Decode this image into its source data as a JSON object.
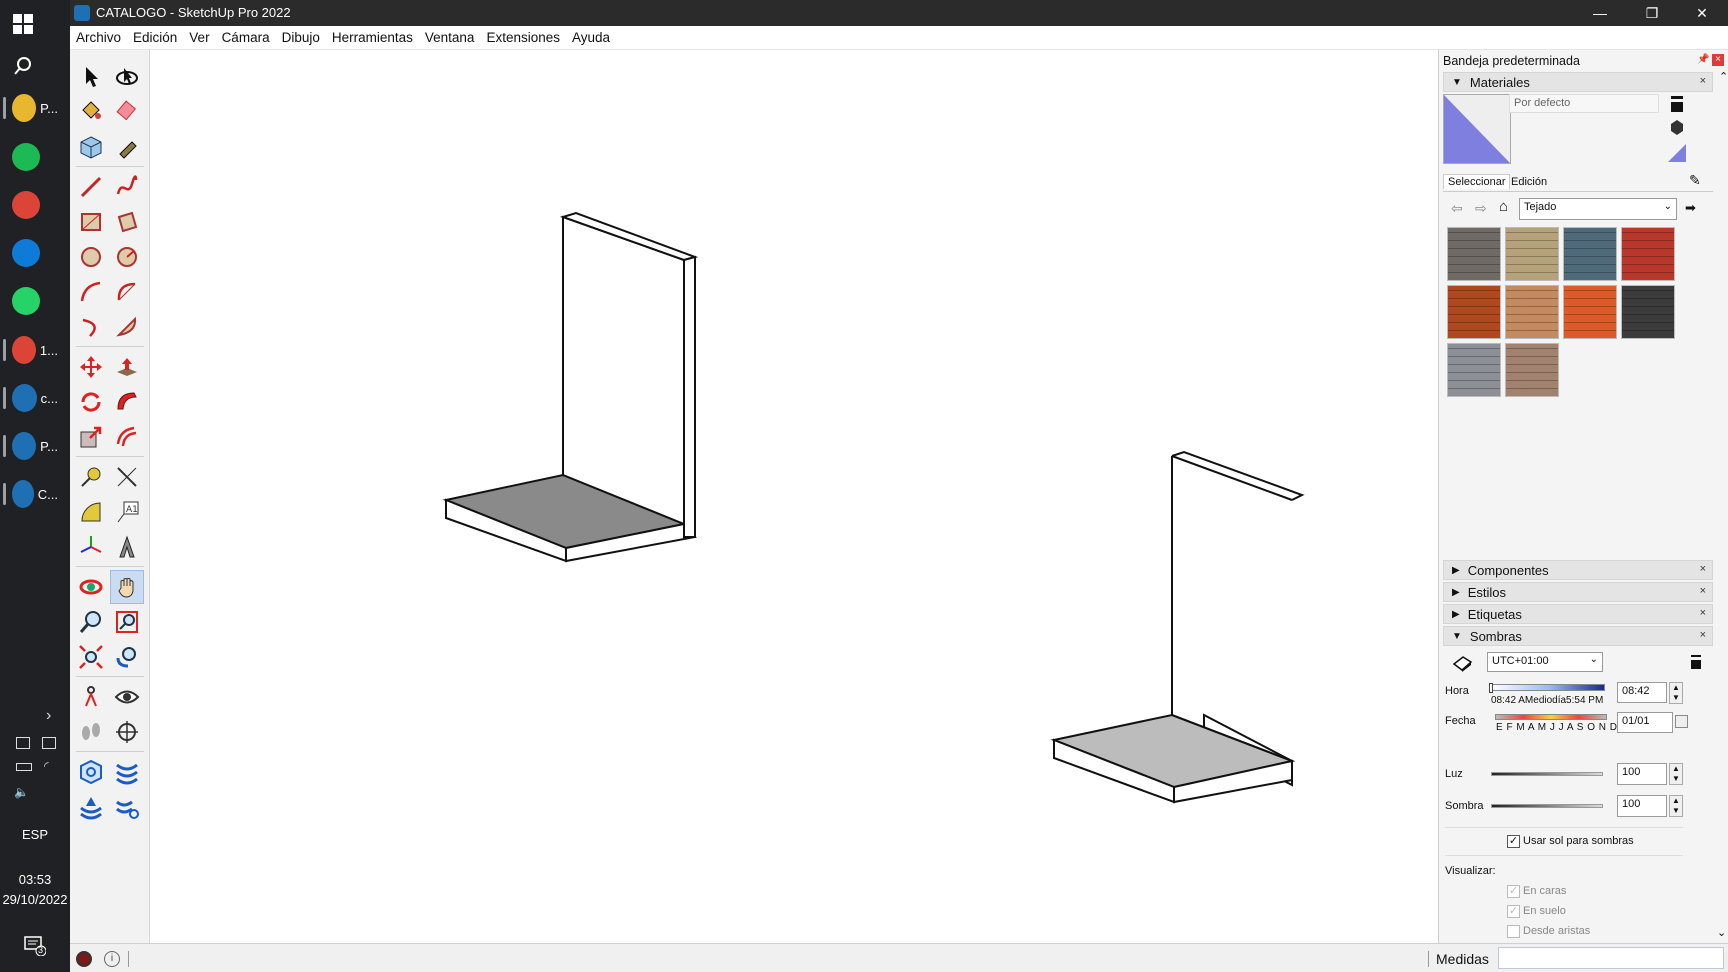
{
  "window": {
    "title": "CATALOGO - SketchUp Pro 2022",
    "minimize": "—",
    "maximize": "❐",
    "close": "✕"
  },
  "menu": [
    "Archivo",
    "Edición",
    "Ver",
    "Cámara",
    "Dibujo",
    "Herramientas",
    "Ventana",
    "Extensiones",
    "Ayuda"
  ],
  "taskbar": {
    "items": [
      {
        "label": "P...",
        "color": "#e8b730"
      },
      {
        "label": "",
        "color": "#1db954"
      },
      {
        "label": "",
        "color": "#db4437"
      },
      {
        "label": "",
        "color": "#0f7bd8"
      },
      {
        "label": "",
        "color": "#25d366"
      },
      {
        "label": "1...",
        "color": "#db4437"
      },
      {
        "label": "c...",
        "color": "#1f6fb5"
      },
      {
        "label": "P...",
        "color": "#1f6fb5"
      },
      {
        "label": "C...",
        "color": "#1f6fb5"
      }
    ],
    "language": "ESP",
    "time": "03:53",
    "date": "29/10/2022",
    "notifications": "3"
  },
  "tray": {
    "title": "Bandeja predeterminada",
    "materials": {
      "header": "Materiales",
      "name_field": "Por defecto",
      "tab_select": "Seleccionar",
      "tab_edit": "Edición",
      "library": "Tejado",
      "swatches": [
        "#6f6a66",
        "#b5a27a",
        "#4f6b7a",
        "#b8392c",
        "#b1471f",
        "#c28a5e",
        "#e0592a",
        "#3b3b3b",
        "#8d8f96",
        "#a1826e"
      ]
    },
    "sections": {
      "components": "Componentes",
      "styles": "Estilos",
      "tags": "Etiquetas",
      "shadows": "Sombras"
    },
    "shadows": {
      "timezone": "UTC+01:00",
      "time_label": "Hora",
      "time_scale": "08:42 AMediodía5:54 PM",
      "time_value": "08:42",
      "date_label": "Fecha",
      "date_scale": "E F M A M J J A S O N D",
      "date_value": "01/01",
      "light_label": "Luz",
      "light_value": "100",
      "shade_label": "Sombra",
      "shade_value": "100",
      "use_sun_label": "Usar sol para sombras",
      "use_sun_checked": true,
      "display_label": "Visualizar:",
      "on_faces": "En caras",
      "on_ground": "En suelo",
      "from_edges": "Desde aristas"
    }
  },
  "status": {
    "measurements_label": "Medidas",
    "measurements_value": ""
  }
}
